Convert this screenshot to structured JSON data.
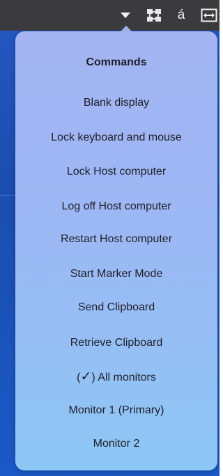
{
  "topbar": {
    "icons": [
      "dropdown-arrow-icon",
      "network-icon",
      "accent-character-icon",
      "resize-icon"
    ],
    "accent_char": "á"
  },
  "menu": {
    "title": "Commands",
    "items": [
      {
        "label": "Blank display"
      },
      {
        "label": "Lock keyboard and mouse"
      },
      {
        "label": "Lock Host computer"
      },
      {
        "label": "Log off Host computer"
      },
      {
        "label": "Restart Host computer"
      },
      {
        "label": "Start Marker Mode"
      },
      {
        "label": "Send Clipboard"
      },
      {
        "label": "Retrieve Clipboard"
      },
      {
        "label": "All monitors",
        "prefix_open": "(",
        "check": "✓",
        "prefix_close": ")",
        "checked": true
      },
      {
        "label": "Monitor 1 (Primary)"
      },
      {
        "label": "Monitor 2"
      }
    ]
  },
  "colors": {
    "topbar": "#3b3b3d",
    "desktop": "#1d4fb0",
    "menu_top": "#a4b4f3",
    "menu_bottom": "#8dc7f5",
    "text": "#1f1f2a"
  }
}
